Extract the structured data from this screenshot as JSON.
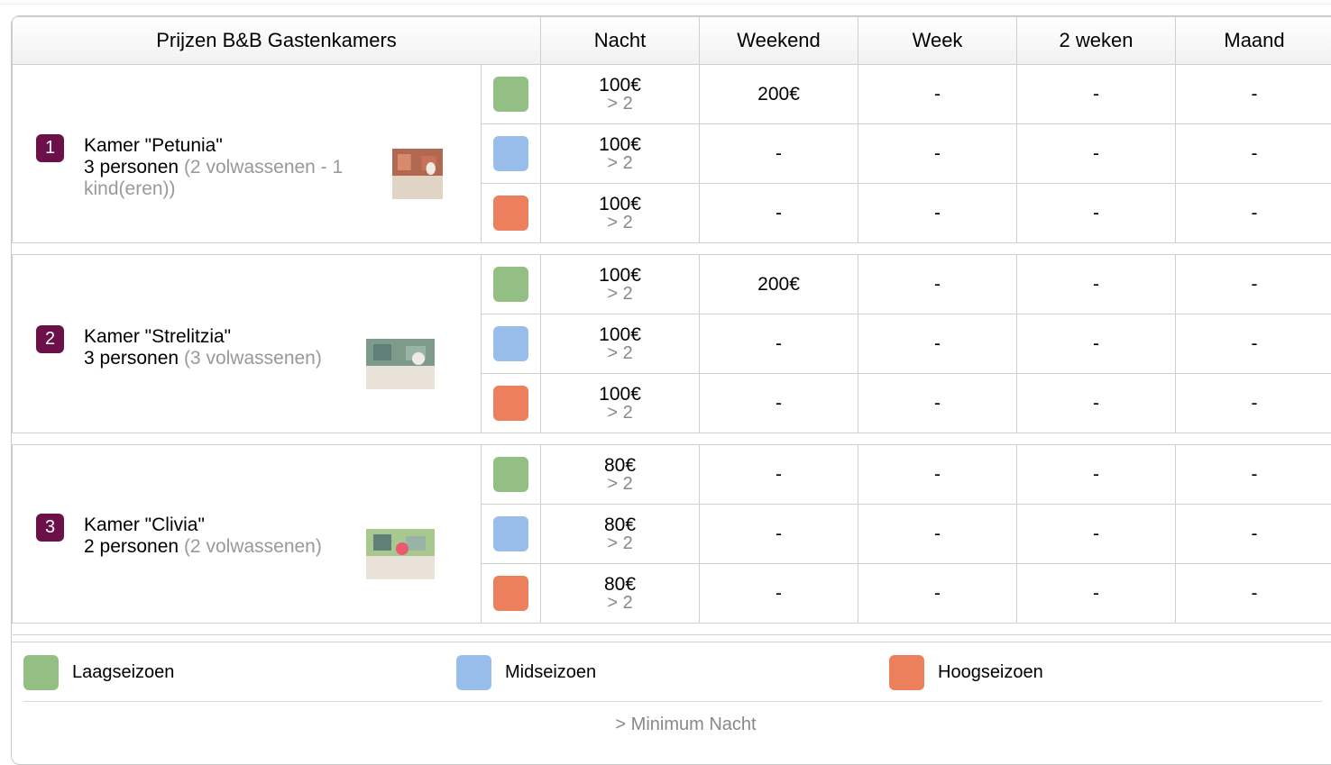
{
  "header": {
    "title": "Prijzen B&B Gastenkamers",
    "cols": [
      "Nacht",
      "Weekend",
      "Week",
      "2 weken",
      "Maand"
    ]
  },
  "rooms": [
    {
      "num": "1",
      "name": "Kamer \"Petunia\"",
      "persons": "3 personen",
      "detail": "(2 volwassenen - 1 kind(eren))",
      "rows": [
        {
          "nacht": "100€",
          "min": "> 2",
          "weekend": "200€",
          "week": "-",
          "weken2": "-",
          "maand": "-"
        },
        {
          "nacht": "100€",
          "min": "> 2",
          "weekend": "-",
          "week": "-",
          "weken2": "-",
          "maand": "-"
        },
        {
          "nacht": "100€",
          "min": "> 2",
          "weekend": "-",
          "week": "-",
          "weken2": "-",
          "maand": "-"
        }
      ]
    },
    {
      "num": "2",
      "name": "Kamer \"Strelitzia\"",
      "persons": "3 personen",
      "detail": "(3 volwassenen)",
      "rows": [
        {
          "nacht": "100€",
          "min": "> 2",
          "weekend": "200€",
          "week": "-",
          "weken2": "-",
          "maand": "-"
        },
        {
          "nacht": "100€",
          "min": "> 2",
          "weekend": "-",
          "week": "-",
          "weken2": "-",
          "maand": "-"
        },
        {
          "nacht": "100€",
          "min": "> 2",
          "weekend": "-",
          "week": "-",
          "weken2": "-",
          "maand": "-"
        }
      ]
    },
    {
      "num": "3",
      "name": "Kamer \"Clivia\"",
      "persons": "2 personen",
      "detail": "(2 volwassenen)",
      "rows": [
        {
          "nacht": "80€",
          "min": "> 2",
          "weekend": "-",
          "week": "-",
          "weken2": "-",
          "maand": "-"
        },
        {
          "nacht": "80€",
          "min": "> 2",
          "weekend": "-",
          "week": "-",
          "weken2": "-",
          "maand": "-"
        },
        {
          "nacht": "80€",
          "min": "> 2",
          "weekend": "-",
          "week": "-",
          "weken2": "-",
          "maand": "-"
        }
      ]
    }
  ],
  "legend": {
    "low": "Laagseizoen",
    "mid": "Midseizoen",
    "high": "Hoogseizoen",
    "note": "> Minimum Nacht"
  },
  "colors": {
    "low": "#93bf85",
    "mid": "#98bdea",
    "high": "#ec805d",
    "badge": "#6b1049"
  }
}
